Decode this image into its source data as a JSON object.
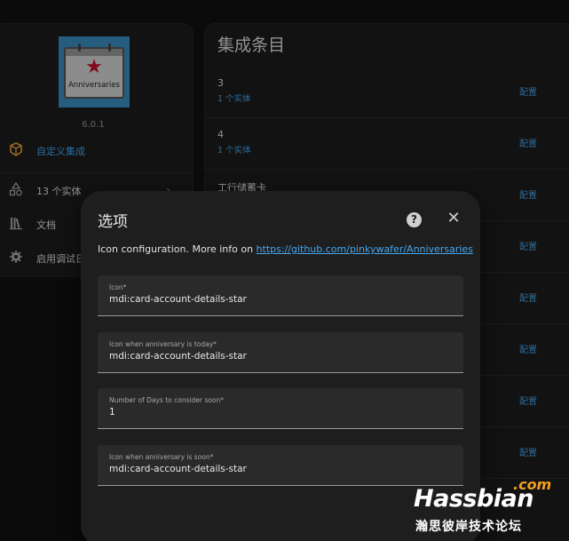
{
  "integration": {
    "logo_text": "Anniversaries",
    "version": "6.0.1",
    "custom_label": "自定义集成",
    "menu": [
      {
        "label": "13 个实体",
        "icon": "shapes-icon"
      },
      {
        "label": "文档",
        "icon": "book-icon"
      },
      {
        "label": "启用调试日",
        "icon": "bug-icon"
      }
    ]
  },
  "entries": {
    "title": "集成条目",
    "items": [
      {
        "name": "3",
        "sub": "1 个实体",
        "action": "配置"
      },
      {
        "name": "4",
        "sub": "1 个实体",
        "action": "配置"
      },
      {
        "name": "工行储蓄卡",
        "sub": "",
        "action": "配置"
      },
      {
        "name": "",
        "sub": "",
        "action": "配置"
      },
      {
        "name": "",
        "sub": "",
        "action": "配置"
      },
      {
        "name": "",
        "sub": "",
        "action": "配置"
      },
      {
        "name": "",
        "sub": "",
        "action": "配置"
      },
      {
        "name": "",
        "sub": "",
        "action": "配置"
      }
    ]
  },
  "dialog": {
    "title": "选项",
    "description": "Icon configuration. More info on ",
    "link": "https://github.com/pinkywafer/Anniversaries",
    "fields": [
      {
        "label": "Icon*",
        "value": "mdi:card-account-details-star"
      },
      {
        "label": "Icon when anniversary is today*",
        "value": "mdi:card-account-details-star"
      },
      {
        "label": "Number of Days to consider soon*",
        "value": "1"
      },
      {
        "label": "Icon when anniversary is soon*",
        "value": "mdi:card-account-details-star"
      }
    ]
  },
  "watermark": {
    "main": "Hassbian",
    "com": ".com",
    "sub": "瀚思彼岸技术论坛"
  },
  "colors": {
    "background": "#111111",
    "card": "#1c1c1c",
    "dialog": "#1e1e1e",
    "accent": "#45a6ee",
    "logo_bg": "#3b8fc4",
    "custom_icon": "#e8a33a"
  }
}
